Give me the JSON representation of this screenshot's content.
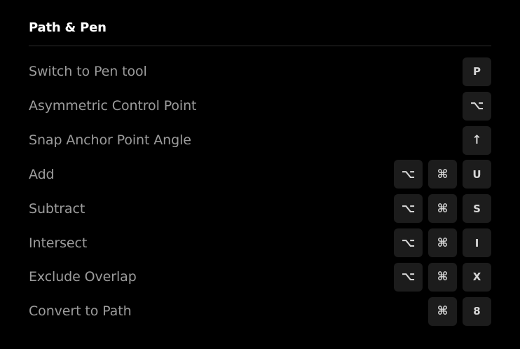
{
  "section": {
    "title": "Path & Pen"
  },
  "shortcuts": [
    {
      "label": "Switch to Pen tool",
      "keys": [
        "P"
      ]
    },
    {
      "label": "Asymmetric Control Point",
      "keys": [
        "⌥"
      ]
    },
    {
      "label": "Snap Anchor Point Angle",
      "keys": [
        "↑"
      ]
    },
    {
      "label": "Add",
      "keys": [
        "⌥",
        "⌘",
        "U"
      ]
    },
    {
      "label": "Subtract",
      "keys": [
        "⌥",
        "⌘",
        "S"
      ]
    },
    {
      "label": "Intersect",
      "keys": [
        "⌥",
        "⌘",
        "I"
      ]
    },
    {
      "label": "Exclude Overlap",
      "keys": [
        "⌥",
        "⌘",
        "X"
      ]
    },
    {
      "label": "Convert to Path",
      "keys": [
        "⌘",
        "8"
      ]
    }
  ],
  "colors": {
    "background": "#000000",
    "title": "#ffffff",
    "label": "#9c9c9c",
    "key_background": "#1c1c1c",
    "key_text": "#d6d6d6",
    "divider": "#2e2e2e"
  }
}
